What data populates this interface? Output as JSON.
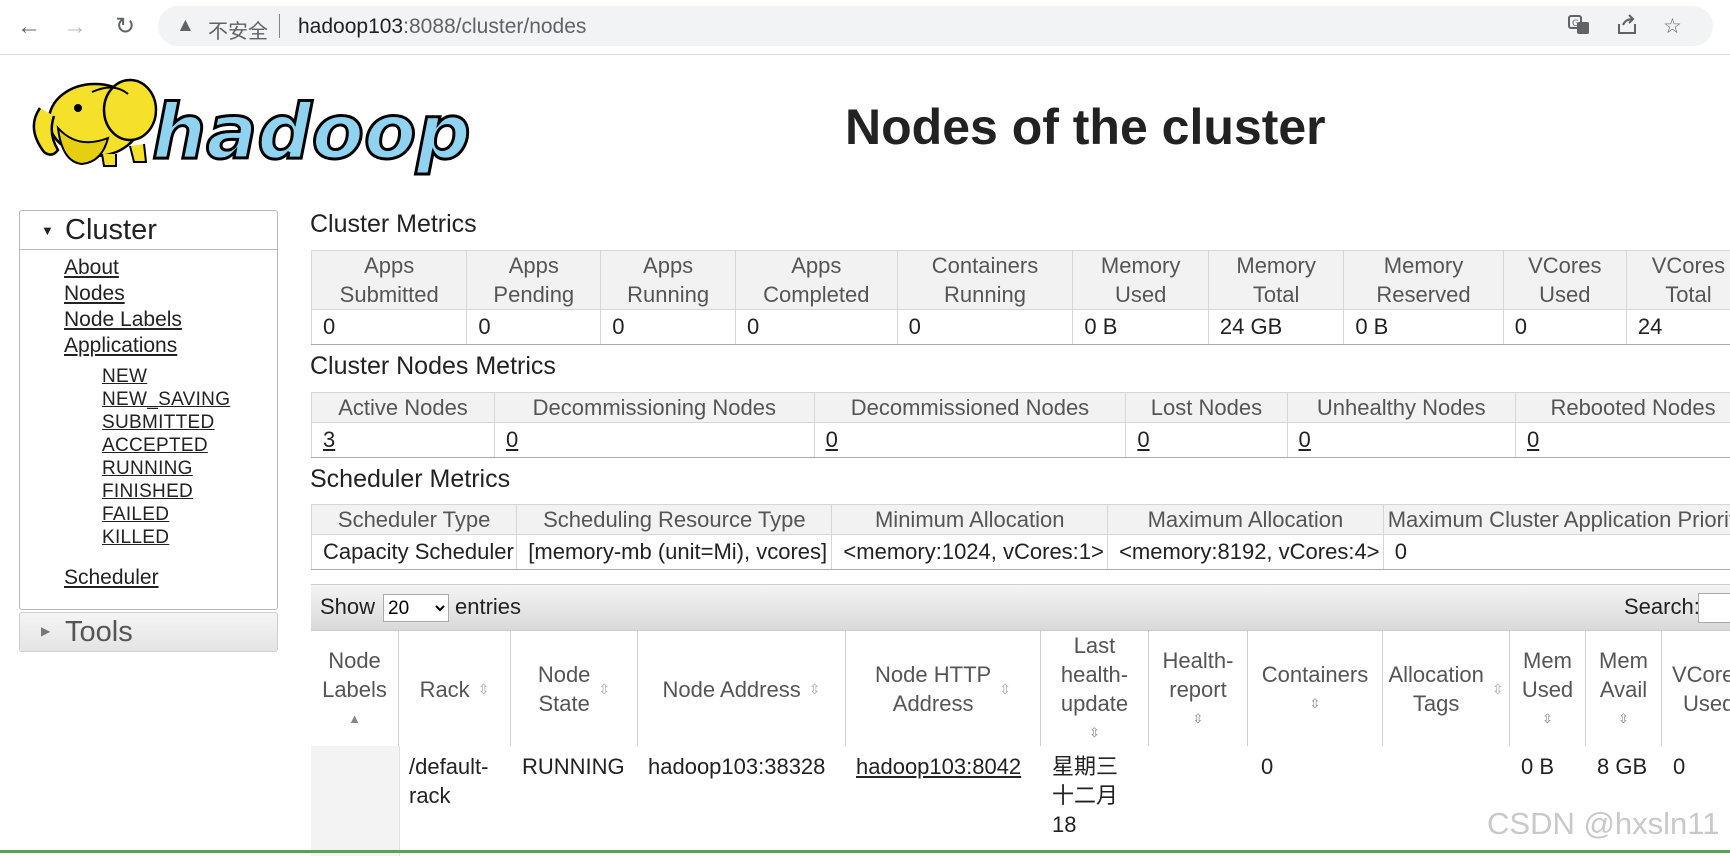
{
  "browser": {
    "insecure_label": "不安全",
    "url_host": "hadoop103",
    "url_rest": ":8088/cluster/nodes"
  },
  "header": {
    "logo_text": "hadoop",
    "title": "Nodes of the cluster"
  },
  "sidebar": {
    "cluster_label": "Cluster",
    "links": [
      "About",
      "Nodes",
      "Node Labels",
      "Applications"
    ],
    "app_states": [
      "NEW",
      "NEW_SAVING",
      "SUBMITTED",
      "ACCEPTED",
      "RUNNING",
      "FINISHED",
      "FAILED",
      "KILLED"
    ],
    "scheduler_label": "Scheduler",
    "tools_label": "Tools"
  },
  "cluster_metrics": {
    "title": "Cluster Metrics",
    "headers": [
      [
        "Apps",
        "Submitted"
      ],
      [
        "Apps",
        "Pending"
      ],
      [
        "Apps",
        "Running"
      ],
      [
        "Apps",
        "Completed"
      ],
      [
        "Containers",
        "Running"
      ],
      [
        "Memory",
        "Used"
      ],
      [
        "Memory",
        "Total"
      ],
      [
        "Memory",
        "Reserved"
      ],
      [
        "VCores",
        "Used"
      ],
      [
        "VCores",
        "Total"
      ]
    ],
    "values": [
      "0",
      "0",
      "0",
      "0",
      "0",
      "0 B",
      "24 GB",
      "0 B",
      "0",
      "24"
    ]
  },
  "node_metrics": {
    "title": "Cluster Nodes Metrics",
    "headers": [
      "Active Nodes",
      "Decommissioning Nodes",
      "Decommissioned Nodes",
      "Lost Nodes",
      "Unhealthy Nodes",
      "Rebooted Nodes"
    ],
    "values": [
      "3",
      "0",
      "0",
      "0",
      "0",
      "0"
    ]
  },
  "scheduler_metrics": {
    "title": "Scheduler Metrics",
    "headers": [
      "Scheduler Type",
      "Scheduling Resource Type",
      "Minimum Allocation",
      "Maximum Allocation",
      "Maximum Cluster Application Priority"
    ],
    "values": [
      "Capacity Scheduler",
      "[memory-mb (unit=Mi), vcores]",
      "<memory:1024, vCores:1>",
      "<memory:8192, vCores:4>",
      "0"
    ]
  },
  "nodes_table": {
    "show_label": "Show",
    "page_size": "20",
    "entries_label": "entries",
    "search_label": "Search:",
    "columns": [
      "Node Labels",
      "Rack",
      "Node State",
      "Node Address",
      "Node HTTP Address",
      "Last health-update",
      "Health-report",
      "Containers",
      "Allocation Tags",
      "Mem Used",
      "Mem Avail",
      "VCores Used"
    ],
    "rows": [
      {
        "node_labels": "",
        "rack": "/default-rack",
        "state": "RUNNING",
        "address": "hadoop103:38328",
        "http_address": "hadoop103:8042",
        "last_health_update": "星期三 十二月 18",
        "health_report": "",
        "containers": "0",
        "allocation_tags": "",
        "mem_used": "0 B",
        "mem_avail": "8 GB",
        "vcores_used": "0"
      }
    ]
  },
  "watermark": "CSDN @hxsln11"
}
